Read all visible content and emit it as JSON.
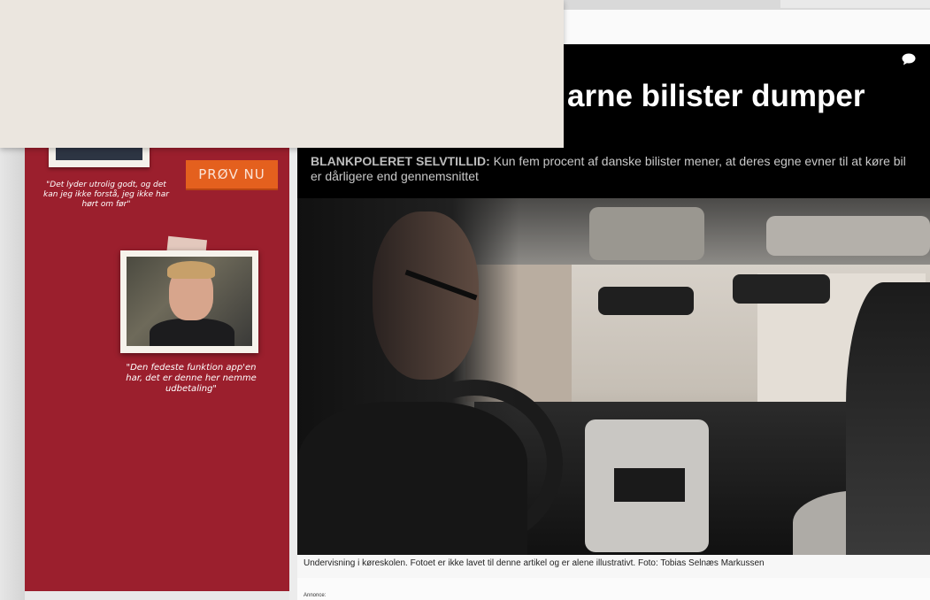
{
  "ad": {
    "quote_1": "\"Det lyder utrolig godt, og det kan jeg ikke forstå, jeg ikke har hørt om før\"",
    "cta_label": "PRØV NU",
    "quote_2": "\"Den fedeste funktion app'en har, det er denne her nemme udbetaling\"",
    "background_color": "#9b1f2d",
    "cta_color": "#e4601e"
  },
  "article": {
    "headline_visible": "arne bilister dumper",
    "subhead_kicker": "BLANKPOLERET SELVTILLID:",
    "subhead_text": " Kun fem procent af danske bilister mener, at deres egne evner til at køre bil er dårligere end gennemsnittet",
    "caption": "Undervisning i køreskolen. Fotoet er ikke lavet til denne artikel og er alene illustrativt. Foto: Tobias Selnæs Markussen",
    "annonce_label": "Annonce:",
    "comment_icon": "speech-bubble-icon"
  }
}
